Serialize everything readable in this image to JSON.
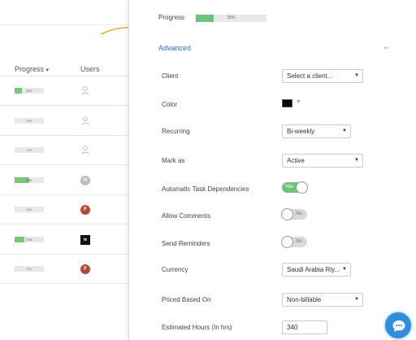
{
  "table": {
    "headers": {
      "progress": "Progress",
      "sort_icon": "▾",
      "users": "Users"
    },
    "rows": [
      {
        "pct": "25%",
        "fill": 0.25,
        "user": "person"
      },
      {
        "pct": "0%",
        "fill": 0,
        "user": "person"
      },
      {
        "pct": "0%",
        "fill": 0,
        "user": "person"
      },
      {
        "pct": "50%",
        "fill": 0.5,
        "user": "H",
        "user_color": "#bdbdbd"
      },
      {
        "pct": "0%",
        "fill": 0,
        "user": "F",
        "user_color": "#b5483b"
      },
      {
        "pct": "33%",
        "fill": 0.33,
        "user": "te",
        "user_color": "#111111"
      },
      {
        "pct": "0%",
        "fill": 0,
        "user": "F",
        "user_color": "#b5483b"
      }
    ]
  },
  "panel": {
    "progress_label": "Progress",
    "progress_pct": "25%",
    "progress_fill": 0.25,
    "advanced_label": "Advanced",
    "fields": {
      "client": {
        "label": "Client",
        "value": "Select a client..."
      },
      "color": {
        "label": "Color",
        "value": "#000000"
      },
      "recurring": {
        "label": "Recurring",
        "value": "Bi-weekly"
      },
      "mark_as": {
        "label": "Mark as",
        "value": "Active"
      },
      "auto_deps": {
        "label": "Automatic Task Dependencies",
        "state": "Yes"
      },
      "allow_comments": {
        "label": "Allow Comments",
        "state": "No"
      },
      "send_reminders": {
        "label": "Send Reminders",
        "state": "No"
      },
      "currency": {
        "label": "Currency",
        "value": "Saudi Arabia Riy..."
      },
      "priced_based_on": {
        "label": "Priced Based On",
        "value": "Non-billable"
      },
      "estimated_hours": {
        "label": "Estimated Hours (In hrs)",
        "value": "340"
      }
    }
  },
  "colors": {
    "accent": "#3a6fc4",
    "success": "#6fc27a",
    "annotation_arrow": "#f5a623",
    "chat": "#2f8fdc"
  }
}
